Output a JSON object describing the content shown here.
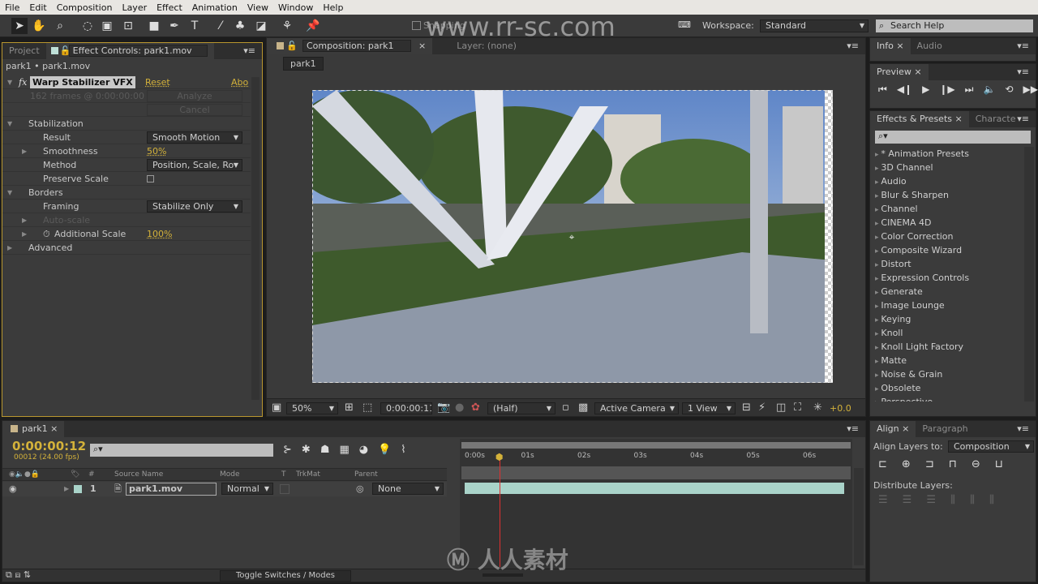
{
  "menu": [
    "File",
    "Edit",
    "Composition",
    "Layer",
    "Effect",
    "Animation",
    "View",
    "Window",
    "Help"
  ],
  "toolbar": {
    "snapping": "Snapping",
    "workspace_label": "Workspace:",
    "workspace_value": "Standard",
    "search_placeholder": "Search Help"
  },
  "watermark": "www.rr-sc.com",
  "effect_panel": {
    "tab_project": "Project",
    "tab_effect": "Effect Controls: park1.mov",
    "breadcrumb": "park1 • park1.mov",
    "effect_name": "Warp Stabilizer VFX",
    "reset": "Reset",
    "about": "Abo",
    "frames_info": "162 frames @ 0:00:00:00",
    "analyze": "Analyze",
    "cancel": "Cancel",
    "rows": [
      {
        "label": "Stabilization",
        "indent": 1,
        "twirl": "open"
      },
      {
        "label": "Result",
        "indent": 2,
        "dropdown": "Smooth Motion"
      },
      {
        "label": "Smoothness",
        "indent": 2,
        "twirl": "closed",
        "value": "50%"
      },
      {
        "label": "Method",
        "indent": 2,
        "dropdown": "Position, Scale, Ro"
      },
      {
        "label": "Preserve Scale",
        "indent": 2,
        "checkbox": false
      },
      {
        "label": "Borders",
        "indent": 1,
        "twirl": "open"
      },
      {
        "label": "Framing",
        "indent": 2,
        "dropdown": "Stabilize Only"
      },
      {
        "label": "Auto-scale",
        "indent": 2,
        "twirl": "closed",
        "disabled": true
      },
      {
        "label": "Additional Scale",
        "indent": 2,
        "twirl": "closed",
        "stopwatch": true,
        "value": "100%"
      },
      {
        "label": "Advanced",
        "indent": 1,
        "twirl": "closed"
      }
    ]
  },
  "comp_panel": {
    "tab": "Composition: park1",
    "layer_tab": "Layer: (none)",
    "comp_button": "park1",
    "zoom": "50%",
    "timecode": "0:00:00:11",
    "resolution": "(Half)",
    "camera": "Active Camera",
    "views": "1 View",
    "exposure": "+0.0"
  },
  "info_panel": {
    "tab_info": "Info",
    "tab_audio": "Audio"
  },
  "preview_panel": {
    "tab": "Preview"
  },
  "effects_presets": {
    "tab": "Effects & Presets",
    "tab2": "Characte",
    "items": [
      "* Animation Presets",
      "3D Channel",
      "Audio",
      "Blur & Sharpen",
      "Channel",
      "CINEMA 4D",
      "Color Correction",
      "Composite Wizard",
      "Distort",
      "Expression Controls",
      "Generate",
      "Image Lounge",
      "Keying",
      "Knoll",
      "Knoll Light Factory",
      "Matte",
      "Noise & Grain",
      "Obsolete",
      "Perspective"
    ]
  },
  "timeline": {
    "tab": "park1",
    "timecode": "0:00:00:12",
    "frame_info": "00012 (24.00 fps)",
    "columns": {
      "source": "Source Name",
      "mode": "Mode",
      "t": "T",
      "trkmat": "TrkMat",
      "parent": "Parent",
      "num": "#"
    },
    "layers": [
      {
        "num": "1",
        "name": "park1.mov",
        "mode": "Normal",
        "parent": "None"
      }
    ],
    "ruler": [
      "0:00s",
      "01s",
      "02s",
      "03s",
      "04s",
      "05s",
      "06s"
    ],
    "toggle": "Toggle Switches / Modes",
    "playhead_seconds": 0.5
  },
  "align_panel": {
    "tab": "Align",
    "tab2": "Paragraph",
    "align_to_label": "Align Layers to:",
    "align_to_value": "Composition",
    "distribute_label": "Distribute Layers:"
  },
  "colors": {
    "accent": "#d4b23a",
    "playhead": "#e03030",
    "layer_bar": "#a9d3c9"
  }
}
